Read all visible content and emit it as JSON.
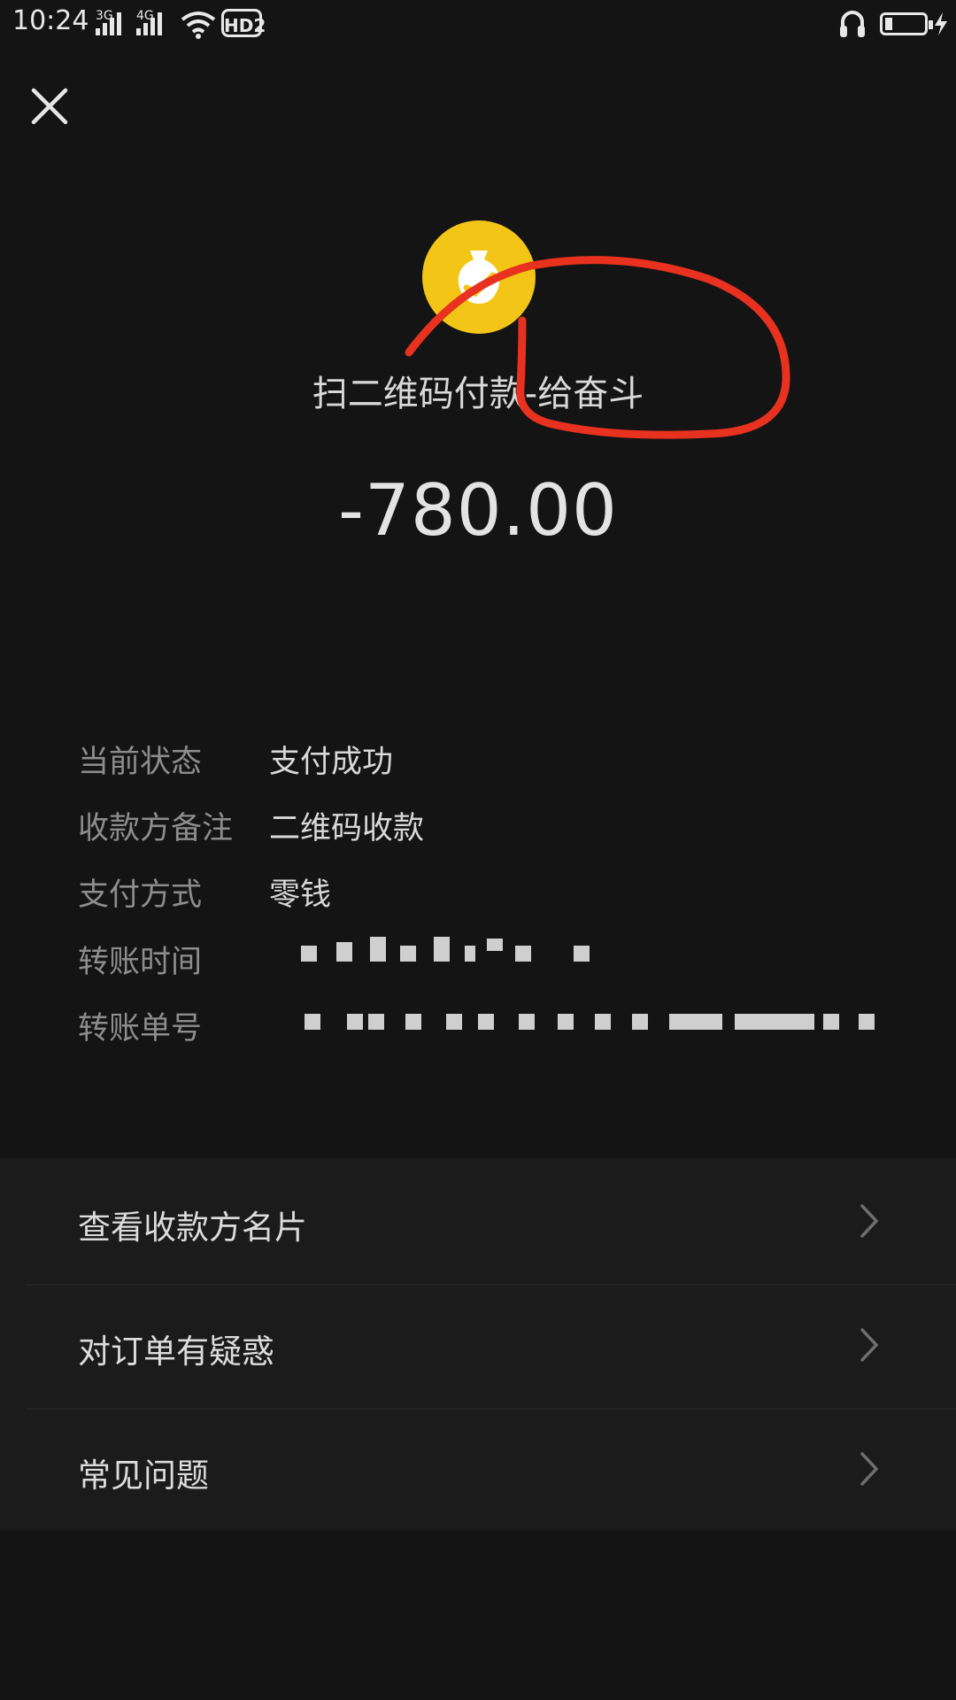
{
  "status_bar": {
    "time": "10:24",
    "network_1": "3G",
    "network_2": "4G",
    "hd_label": "HD2"
  },
  "header": {
    "title": "扫二维码付款-给奋斗",
    "amount": "-780.00",
    "coin_color": "#f2c516",
    "annotation_color": "#e8311f"
  },
  "details": [
    {
      "label": "当前状态",
      "value": "支付成功"
    },
    {
      "label": "收款方备注",
      "value": "二维码收款"
    },
    {
      "label": "支付方式",
      "value": "零钱"
    },
    {
      "label": "转账时间",
      "value": ""
    },
    {
      "label": "转账单号",
      "value": ""
    }
  ],
  "menu": [
    {
      "label": "查看收款方名片"
    },
    {
      "label": "对订单有疑惑"
    },
    {
      "label": "常见问题"
    }
  ]
}
